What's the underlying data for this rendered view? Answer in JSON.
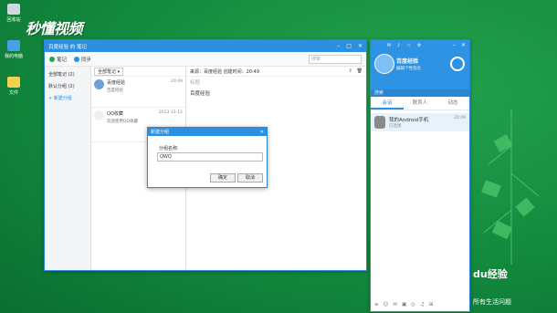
{
  "desktop": {
    "icons": [
      {
        "label": "回收站",
        "icon": "recycle-bin-icon"
      },
      {
        "label": "我的电脑",
        "icon": "computer-icon"
      },
      {
        "label": "文件",
        "icon": "file-icon"
      }
    ],
    "brand": "秒懂视频"
  },
  "notes_window": {
    "title": "百度经验 的 笔记",
    "new_note_label": "笔记",
    "sync_label": "同步",
    "search_placeholder": "搜索",
    "folders": [
      {
        "label": "全部笔记 (2)"
      },
      {
        "label": "默认分组 (2)"
      },
      {
        "label": "+ 新建分组"
      }
    ],
    "sort_label": "全部笔记 ▾",
    "notes": [
      {
        "title": "百度经验",
        "snippet": "百度经验",
        "date": "20:49"
      },
      {
        "title": "QQ收藏",
        "snippet": "欢迎使用QQ收藏",
        "date": "2013-12-12"
      }
    ],
    "editor": {
      "meta": "来源：百度经验  创建时间：20:49",
      "title_placeholder": "标题",
      "body": "百度经验"
    }
  },
  "dialog": {
    "title": "新建分组",
    "field_label": "分组名称:",
    "field_value": "QWQ",
    "confirm_label": "确定",
    "cancel_label": "取消"
  },
  "qq_panel": {
    "name": "百度经验",
    "signature": "编辑个性签名",
    "search_placeholder": "搜索",
    "tabs": [
      "会话",
      "联系人",
      "动态"
    ],
    "conversation": {
      "name": "我的Android手机",
      "sub": "已连接",
      "time": "20:49"
    }
  },
  "watermark": {
    "logo": "du经验",
    "tagline": "所有生活问题"
  },
  "colors": {
    "accent": "#2d8fe0",
    "desktop": "#138a3e"
  }
}
